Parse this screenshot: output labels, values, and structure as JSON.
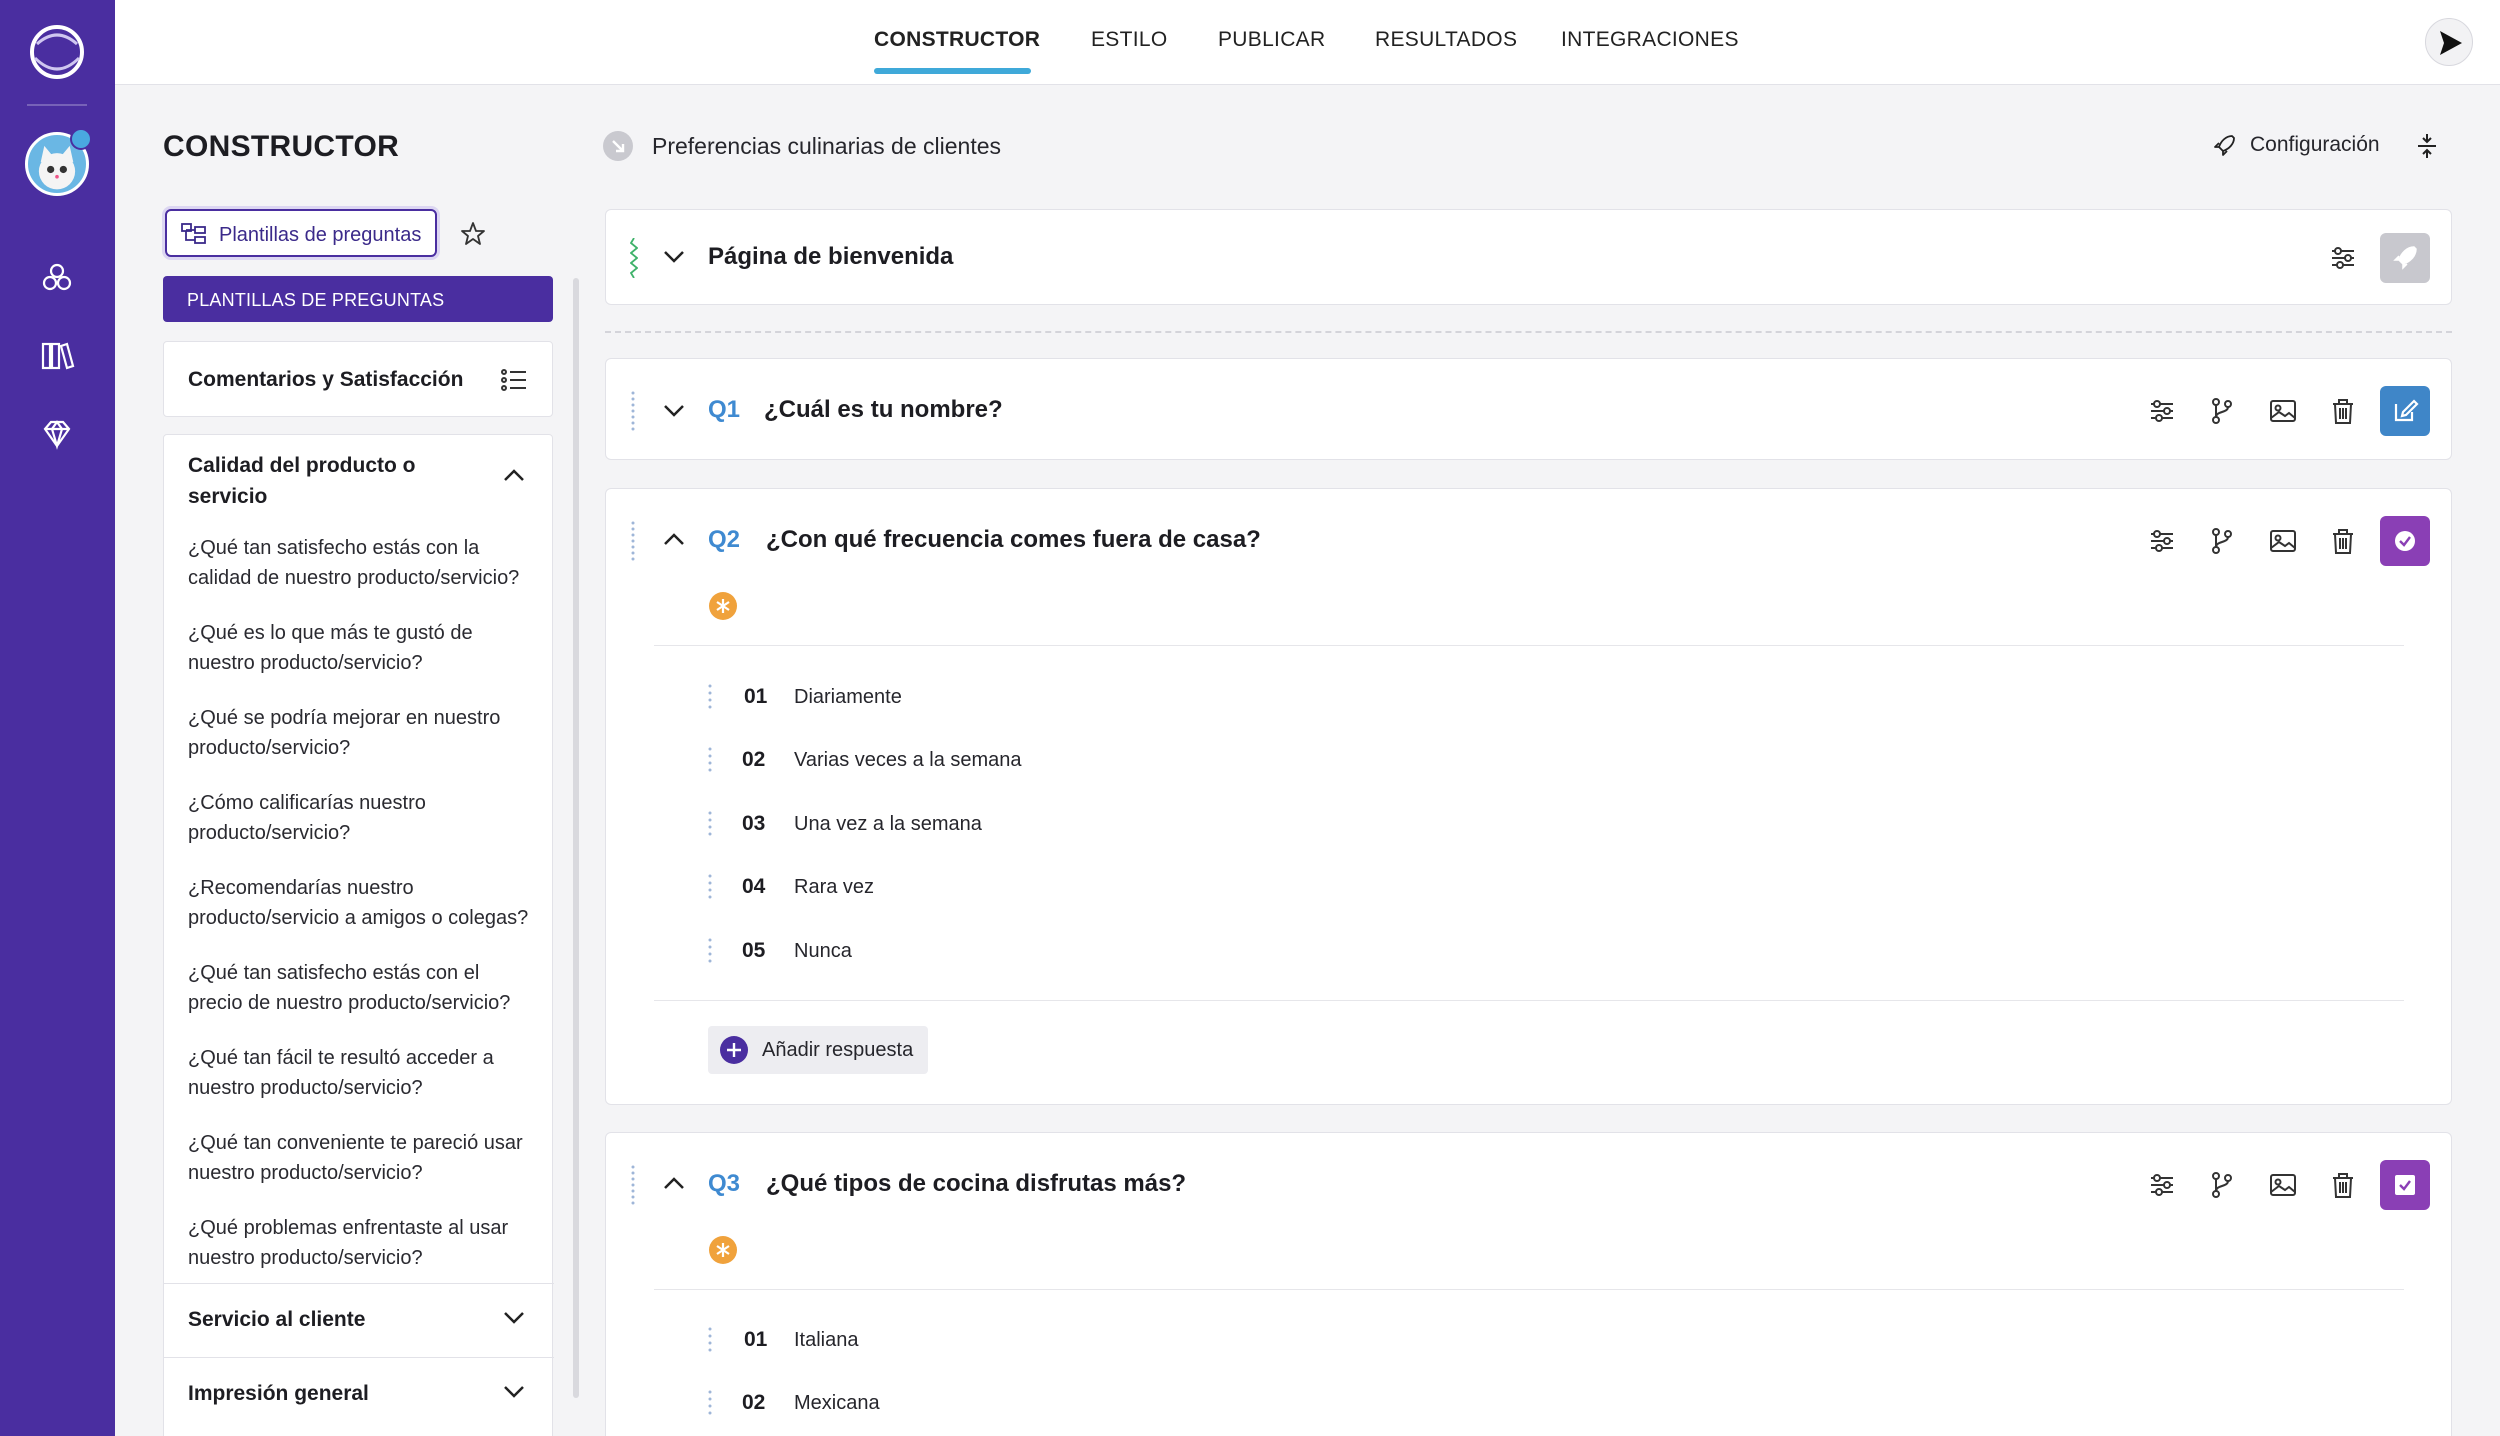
{
  "nav": {
    "tabs": [
      "CONSTRUCTOR",
      "ESTILO",
      "PUBLICAR",
      "RESULTADOS",
      "INTEGRACIONES"
    ],
    "active_tab": "CONSTRUCTOR"
  },
  "sidebar": {
    "title": "CONSTRUCTOR",
    "templates_button": "Plantillas de preguntas",
    "templates_header": "PLANTILLAS DE PREGUNTAS",
    "category_feedback": "Comentarios y Satisfacción",
    "section_open": {
      "title": "Calidad del producto o servicio",
      "questions": [
        "¿Qué tan satisfecho estás con la calidad de nuestro producto/servicio?",
        "¿Qué es lo que más te gustó de nuestro producto/servicio?",
        "¿Qué se podría mejorar en nuestro producto/servicio?",
        "¿Cómo calificarías nuestro producto/servicio?",
        "¿Recomendarías nuestro producto/servicio a amigos o colegas?",
        "¿Qué tan satisfecho estás con el precio de nuestro producto/servicio?",
        "¿Qué tan fácil te resultó acceder a nuestro producto/servicio?",
        "¿Qué tan conveniente te pareció usar nuestro producto/servicio?",
        "¿Qué problemas enfrentaste al usar nuestro producto/servicio?"
      ]
    },
    "sections_closed": [
      "Servicio al cliente",
      "Impresión general"
    ]
  },
  "main": {
    "survey_title": "Preferencias culinarias de clientes",
    "config_label": "Configuración",
    "welcome_title": "Página de bienvenida",
    "questions": [
      {
        "num": "Q1",
        "title": "¿Cuál es tu nombre?"
      },
      {
        "num": "Q2",
        "title": "¿Con qué frecuencia comes fuera de casa?",
        "answers": [
          {
            "num": "01",
            "text": "Diariamente"
          },
          {
            "num": "02",
            "text": "Varias veces a la semana"
          },
          {
            "num": "03",
            "text": "Una vez a la semana"
          },
          {
            "num": "04",
            "text": "Rara vez"
          },
          {
            "num": "05",
            "text": "Nunca"
          }
        ],
        "add_answer": "Añadir respuesta"
      },
      {
        "num": "Q3",
        "title": "¿Qué tipos de cocina disfrutas más?",
        "answers": [
          {
            "num": "01",
            "text": "Italiana"
          },
          {
            "num": "02",
            "text": "Mexicana"
          }
        ]
      }
    ]
  },
  "colors": {
    "brand_purple": "#4a2ea0",
    "accent_blue": "#3f8ad1",
    "tab_underline": "#3fa9d9",
    "required_orange": "#f0a23c",
    "q1_action": "#3f86c8",
    "q2_q3_action": "#8a3fb5"
  },
  "icons": [
    "app-logo",
    "avatar",
    "components-icon",
    "library-icon",
    "diamond-icon",
    "send-icon",
    "template-icon",
    "star-icon",
    "list-icon",
    "chevron-up-icon",
    "chevron-down-icon",
    "collapse-icon",
    "rocket-icon",
    "compress-icon",
    "drag-handle-icon",
    "settings-sliders-icon",
    "branch-icon",
    "image-icon",
    "trash-icon",
    "edit-icon",
    "check-circle-icon",
    "check-square-icon",
    "asterisk-icon",
    "plus-icon"
  ]
}
